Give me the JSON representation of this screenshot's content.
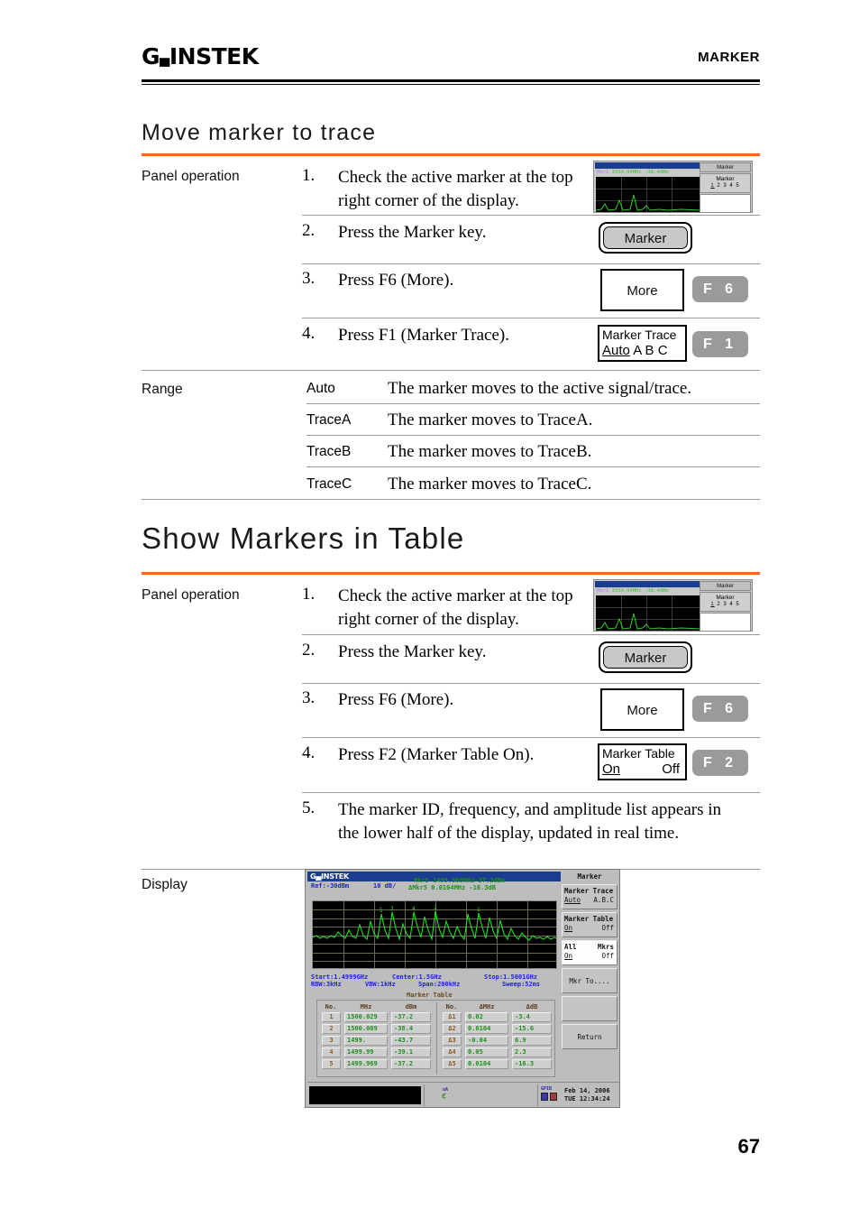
{
  "header": {
    "logo": "GW INSTEK",
    "chapter": "MARKER"
  },
  "footer": {
    "page_number": "67"
  },
  "section1": {
    "title": "Move marker to trace",
    "panel_label": "Panel operation",
    "steps": [
      {
        "num": "1.",
        "text": "Check the active marker at the top right corner of  the display."
      },
      {
        "num": "2.",
        "text": "Press the Marker key."
      },
      {
        "num": "3.",
        "text": "Press F6 (More)."
      },
      {
        "num": "4.",
        "text": "Press F1 (Marker Trace)."
      }
    ],
    "marker_key_label": "Marker",
    "more_key_label": "More",
    "f6_label": "F 6",
    "f1_label": "F 1",
    "marker_trace_softkey": {
      "title": "Marker Trace",
      "selected": "Auto",
      "options": "A B C"
    },
    "range_label": "Range",
    "range_rows": [
      {
        "key": "Auto",
        "desc": "The marker moves to the active signal/trace."
      },
      {
        "key": "TraceA",
        "desc": "The marker moves to TraceA."
      },
      {
        "key": "TraceB",
        "desc": "The marker moves to TraceB."
      },
      {
        "key": "TraceC",
        "desc": "The marker moves to TraceC."
      }
    ]
  },
  "section2": {
    "title": "Show Markers in Table",
    "panel_label": "Panel operation",
    "steps": [
      {
        "num": "1.",
        "text": "Check the active marker at the top right corner of  the display."
      },
      {
        "num": "2.",
        "text": "Press the Marker key."
      },
      {
        "num": "3.",
        "text": "Press F6 (More)."
      },
      {
        "num": "4.",
        "text": "Press F2 (Marker Table On)."
      },
      {
        "num": "5.",
        "text": "The marker ID, frequency, and amplitude list appears in the lower half of  the display, updated in real time."
      }
    ],
    "marker_key_label": "Marker",
    "more_key_label": "More",
    "f6_label": "F 6",
    "f2_label": "F 2",
    "marker_table_softkey": {
      "title": "Marker Table",
      "on": "On",
      "off": "Off"
    },
    "display_label": "Display"
  },
  "thumbnail": {
    "reading_prefix": "Mkr1",
    "reading": "1500.04MHz -38.4dBm",
    "menu_title": "Marker",
    "key_line1": "Marker",
    "key_line2_selected": "1",
    "key_line2_rest": "2 3 4 5"
  },
  "display": {
    "logo": "GW INSTEK",
    "ref": "Ref:-30dBm",
    "scale": "10 dB/",
    "marker_reading": "Mkr5 1499.969MHz-37.2dBm",
    "delta_reading": "ΔMkr5 0.0104MHz  -16.3dB",
    "start": "Start:1.4999GHz",
    "center": "Center:1.5GHz",
    "stop": "Stop:1.5001GHz",
    "rbw": "RBW:3kHz",
    "vbw": "VBW:1kHz",
    "span": "Span:200kHz",
    "sweep": "Sweep:52ms",
    "marker_table_title": "Marker Table",
    "table_left": {
      "headers": [
        "No.",
        "MHz",
        "dBm"
      ],
      "rows": [
        [
          "1",
          "1500.029",
          "-37.2"
        ],
        [
          "2",
          "1500.009",
          "-38.4"
        ],
        [
          "3",
          "1499.",
          "-43.7"
        ],
        [
          "4",
          "1499.99",
          "-39.1"
        ],
        [
          "5",
          "1499.969",
          "-37.2"
        ]
      ]
    },
    "table_right": {
      "headers": [
        "No.",
        "ΔMHz",
        "ΔdB"
      ],
      "rows": [
        [
          "Δ1",
          "0.02",
          "-3.4"
        ],
        [
          "Δ2",
          "0.0104",
          "-15.6"
        ],
        [
          "Δ3",
          "-0.04",
          "6.9"
        ],
        [
          "Δ4",
          "0.05",
          "2.3"
        ],
        [
          "Δ5",
          "0.0104",
          "-16.3"
        ]
      ]
    },
    "softkeys": {
      "title": "Marker",
      "items": [
        {
          "line1": "Marker Trace",
          "sel": "Auto",
          "alt": "A.B.C"
        },
        {
          "line1": "Marker Table",
          "sel": "On",
          "alt": "Off"
        },
        {
          "line1": "All",
          "line1r": "Mkrs",
          "sel": "On",
          "alt": "Off"
        },
        {
          "center": "Mkr To...."
        },
        {
          "center": ""
        },
        {
          "center": "Return"
        }
      ]
    },
    "status": {
      "date": "Feb 14, 2006",
      "time": "TUE 12:34:24"
    }
  },
  "colors": {
    "accent": "#f26522",
    "screen_blue": "#2222cc",
    "trace_green": "#1e8e1e"
  }
}
